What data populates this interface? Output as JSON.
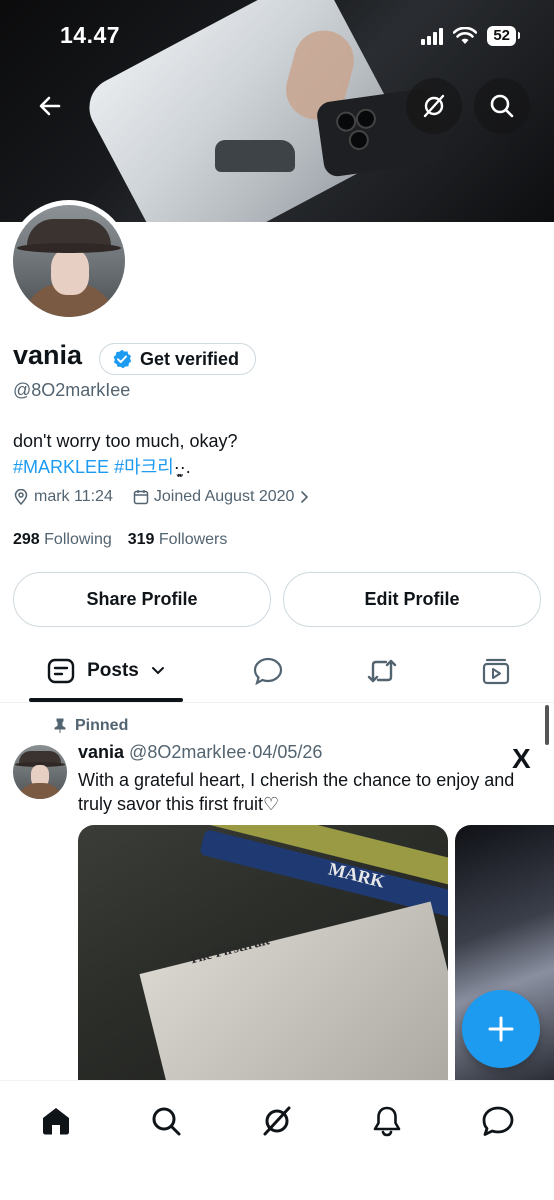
{
  "status_bar": {
    "time": "14.47",
    "battery": "52"
  },
  "header": {
    "back_label": "←"
  },
  "profile": {
    "name": "vania",
    "get_verified_label": "Get verified",
    "handle": "@8O2markIee",
    "bio_line1": "don't worry too much, okay?",
    "hashtag1": "#MARKLEE",
    "hashtag2": "#마크리",
    "bio_emoji": "·͈̫·.",
    "location": "mark 11:24",
    "joined": "Joined August 2020",
    "following_count": "298",
    "following_label": "Following",
    "followers_count": "319",
    "followers_label": "Followers",
    "share_button": "Share Profile",
    "edit_button": "Edit Profile"
  },
  "tabs": {
    "posts_label": "Posts"
  },
  "post": {
    "pinned_label": "Pinned",
    "author_name": "vania",
    "author_handle": "@8O2markIee",
    "separator": "·",
    "date": "04/05/26",
    "text": "With a grateful heart, I cherish the chance to enjoy and truly savor this first fruit♡",
    "x_logo": "X",
    "media1_title": "The Firstfruit",
    "media1_brand": "MARK"
  },
  "colors": {
    "accent": "#1d9bf0",
    "text": "#0f1419",
    "muted": "#536471"
  }
}
